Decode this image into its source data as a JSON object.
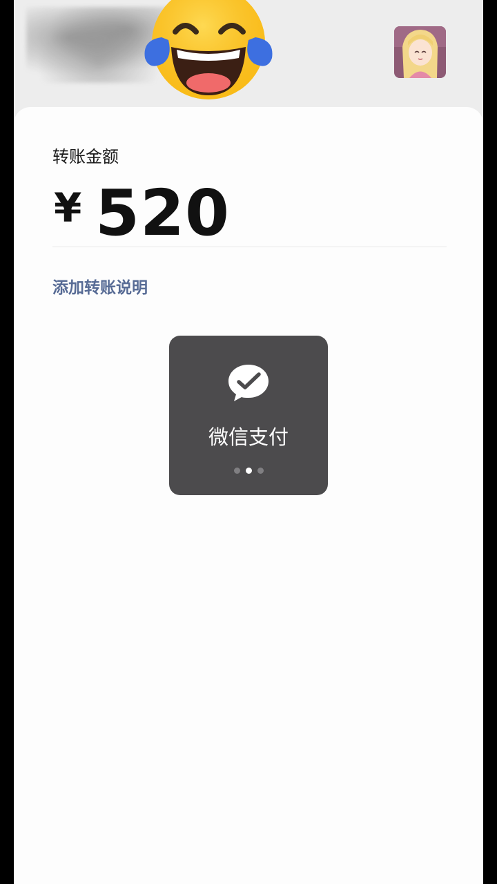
{
  "header": {
    "emoji_icon": "face-with-tears-of-joy-icon",
    "avatar_icon": "blonde-cartoon-girl-avatar"
  },
  "transfer": {
    "amount_label": "转账金额",
    "currency_symbol": "¥",
    "amount": "520",
    "add_note_label": "添加转账说明"
  },
  "toast": {
    "icon": "wechat-pay-icon",
    "text": "微信支付",
    "page_count": 3,
    "active_page": 2
  },
  "colors": {
    "link": "#576b95",
    "toast_bg": "#4c4b4d",
    "header_bg": "#ededed"
  }
}
